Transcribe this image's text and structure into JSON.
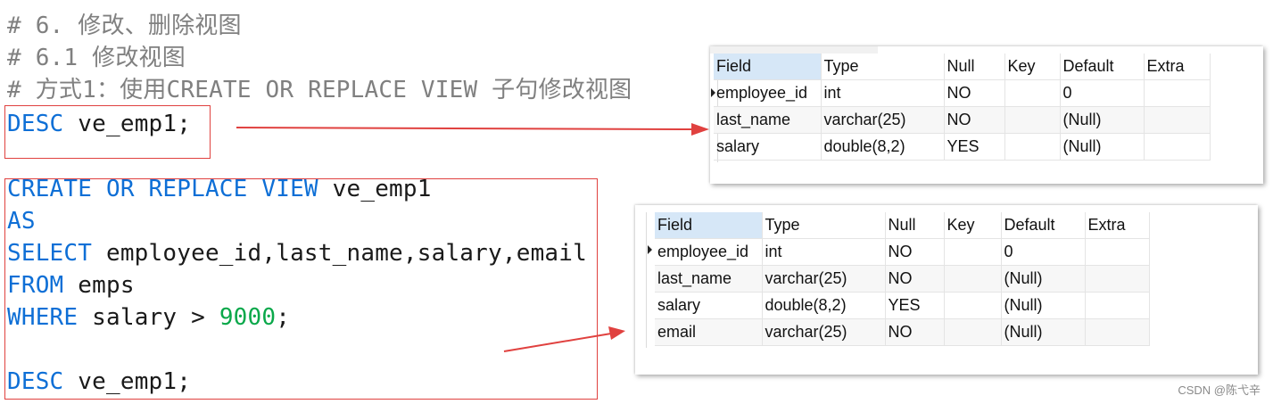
{
  "code": {
    "comment1": "# 6. 修改、删除视图",
    "comment2": "# 6.1 修改视图",
    "comment3": "# 方式1：使用CREATE OR REPLACE VIEW 子句修改视图",
    "desc_kw": "DESC",
    "desc_target": " ve_emp1;",
    "create_kw": "CREATE OR REPLACE VIEW",
    "create_target": " ve_emp1",
    "as_kw": "AS",
    "select_kw": "SELECT",
    "select_cols": " employee_id,last_name,salary,email",
    "from_kw": "FROM",
    "from_target": " emps",
    "where_kw": "WHERE",
    "where_cond": " salary > ",
    "where_value": "9000",
    "where_end": ";",
    "desc2_kw": "DESC",
    "desc2_target": " ve_emp1;"
  },
  "colors": {
    "keyword": "#0e6fd6",
    "comment": "#808080",
    "number": "#0aa84a",
    "annotation_red": "#e0413f",
    "selected_header": "#d6e7f7"
  },
  "result1": {
    "headers": [
      "Field",
      "Type",
      "Null",
      "Key",
      "Default",
      "Extra"
    ],
    "rows": [
      [
        "employee_id",
        "int",
        "NO",
        "",
        "0",
        ""
      ],
      [
        "last_name",
        "varchar(25)",
        "NO",
        "",
        "(Null)",
        ""
      ],
      [
        "salary",
        "double(8,2)",
        "YES",
        "",
        "(Null)",
        ""
      ]
    ]
  },
  "result2": {
    "headers": [
      "Field",
      "Type",
      "Null",
      "Key",
      "Default",
      "Extra"
    ],
    "rows": [
      [
        "employee_id",
        "int",
        "NO",
        "",
        "0",
        ""
      ],
      [
        "last_name",
        "varchar(25)",
        "NO",
        "",
        "(Null)",
        ""
      ],
      [
        "salary",
        "double(8,2)",
        "YES",
        "",
        "(Null)",
        ""
      ],
      [
        "email",
        "varchar(25)",
        "NO",
        "",
        "(Null)",
        ""
      ]
    ]
  },
  "watermark": "CSDN @陈弋辛"
}
